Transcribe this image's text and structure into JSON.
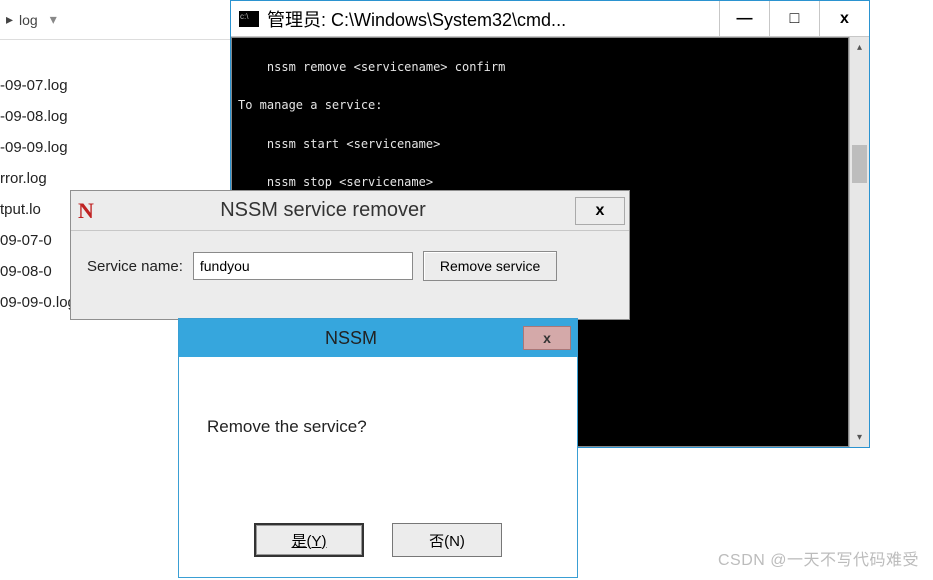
{
  "explorer": {
    "breadcrumb_segment": "log",
    "items": [
      "-09-07.log",
      "-09-08.log",
      "-09-09.log",
      "rror.log",
      "tput.lo",
      "09-07-0",
      "09-08-0",
      "09-09-0.log"
    ]
  },
  "cmd": {
    "title": "管理员: C:\\Windows\\System32\\cmd...",
    "btn_min": "—",
    "btn_max": "□",
    "btn_close": "x",
    "lines": [
      "    nssm remove <servicename> confirm",
      "",
      "To manage a service:",
      "",
      "    nssm start <servicename>",
      "",
      "    nssm stop <servicename>"
    ]
  },
  "remover": {
    "icon": "N",
    "title": "NSSM service remover",
    "close": "x",
    "label": "Service name:",
    "value": "fundyou",
    "button": "Remove service"
  },
  "confirm": {
    "title": "NSSM",
    "close": "x",
    "message": "Remove the service?",
    "yes": "是(Y)",
    "no": "否(N)"
  },
  "watermark": "CSDN @一天不写代码难受"
}
